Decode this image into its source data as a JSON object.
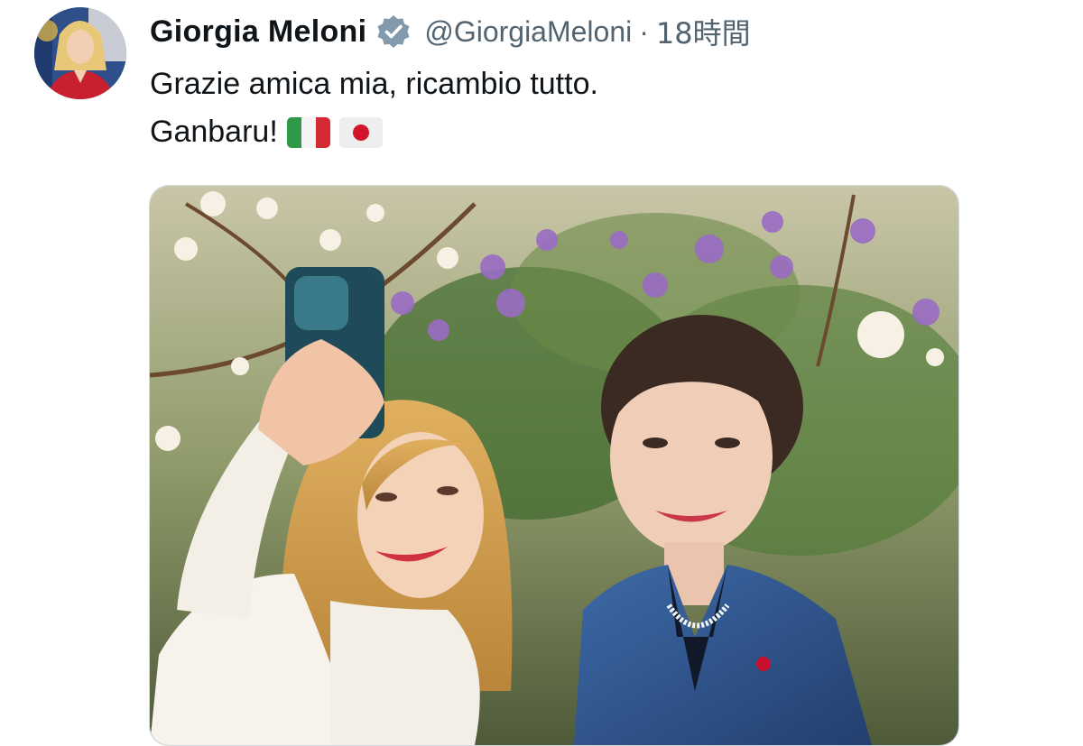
{
  "tweet": {
    "author": {
      "display_name": "Giorgia Meloni",
      "handle": "@GiorgiaMeloni",
      "verified": true,
      "avatar_icon": "profile-photo"
    },
    "separator": "·",
    "timestamp": "18時間",
    "text_line_1": "Grazie amica mia, ricambio tutto.",
    "text_line_2": "Ganbaru!",
    "emoji": [
      "italy-flag",
      "japan-flag"
    ],
    "media": {
      "type": "photo",
      "icon": "photo"
    }
  },
  "colors": {
    "text_primary": "#0f1419",
    "text_secondary": "#536471",
    "verified_badge": "#829aab",
    "border": "#cfd9de"
  }
}
